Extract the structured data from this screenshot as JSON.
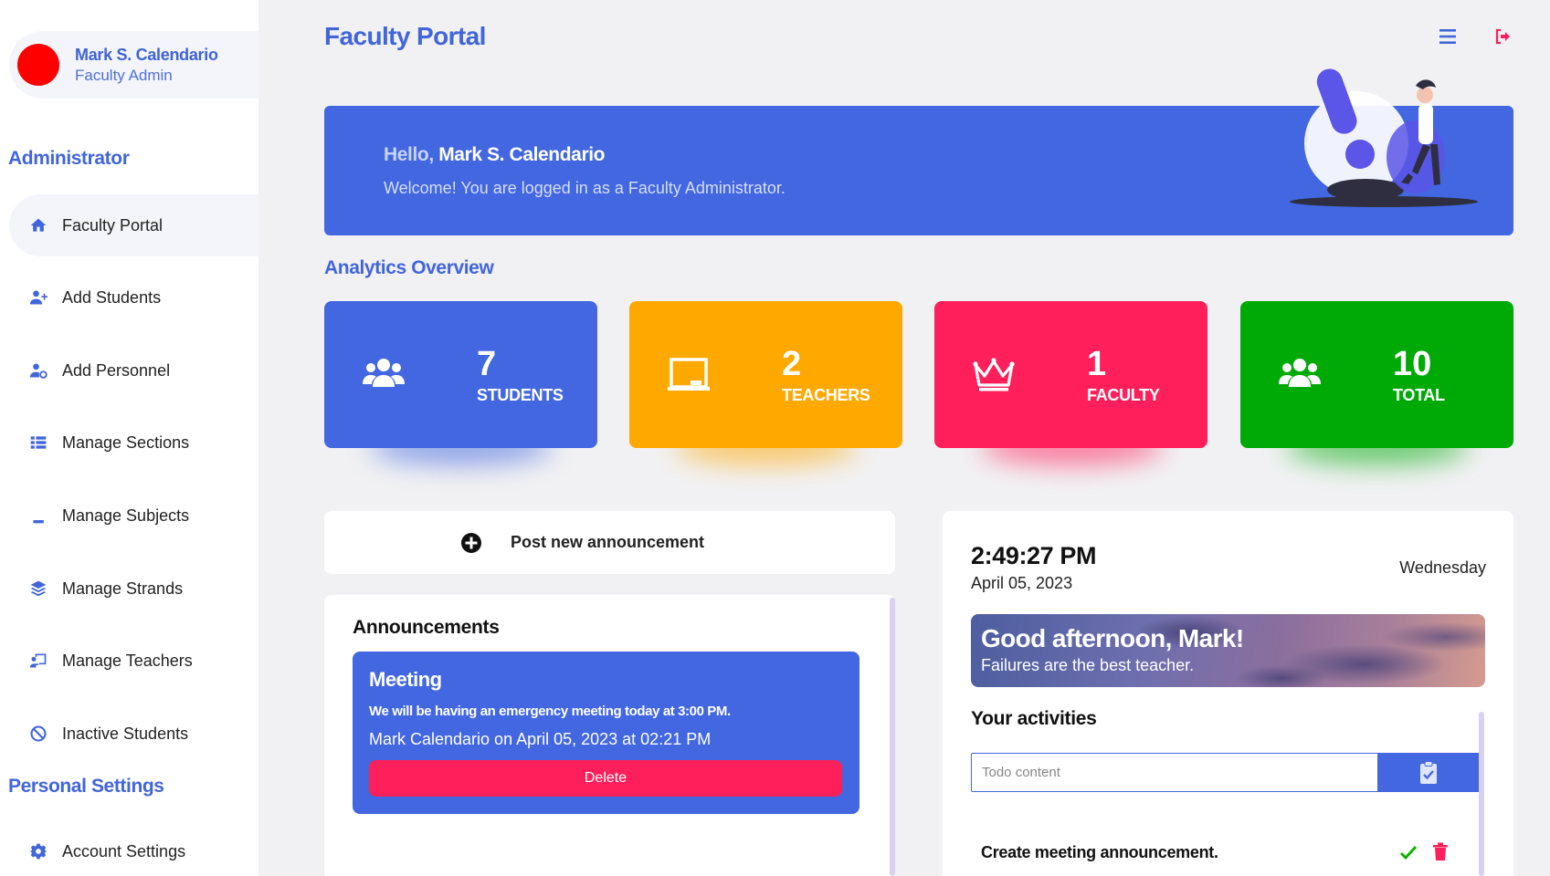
{
  "sidebar": {
    "profile": {
      "name": "Mark S. Calendario",
      "role": "Faculty Admin"
    },
    "section_admin": "Administrator",
    "items": [
      {
        "label": "Faculty Portal",
        "icon": "home-icon"
      },
      {
        "label": "Add Students",
        "icon": "user-plus-icon"
      },
      {
        "label": "Add Personnel",
        "icon": "user-cog-icon"
      },
      {
        "label": "Manage Sections",
        "icon": "list-icon"
      },
      {
        "label": "Manage Subjects",
        "icon": "book-icon"
      },
      {
        "label": "Manage Strands",
        "icon": "layers-icon"
      },
      {
        "label": "Manage Teachers",
        "icon": "chalkboard-teacher-icon"
      },
      {
        "label": "Inactive Students",
        "icon": "ban-icon"
      }
    ],
    "section_personal": "Personal Settings",
    "personal_items": [
      {
        "label": "Account Settings",
        "icon": "gear-icon"
      }
    ]
  },
  "header": {
    "title": "Faculty Portal"
  },
  "hero": {
    "hello": "Hello,",
    "name": "Mark S. Calendario",
    "welcome": "Welcome! You are logged in as a Faculty Administrator."
  },
  "analytics": {
    "title": "Analytics Overview",
    "cards": [
      {
        "value": "7",
        "label": "STUDENTS",
        "color": "#4267e0",
        "icon": "users-icon"
      },
      {
        "value": "2",
        "label": "TEACHERS",
        "color": "#ffa800",
        "icon": "chalkboard-icon"
      },
      {
        "value": "1",
        "label": "FACULTY",
        "color": "#ff1f5a",
        "icon": "crown-icon"
      },
      {
        "value": "10",
        "label": "TOTAL",
        "color": "#00aa06",
        "icon": "users-icon"
      }
    ]
  },
  "announcements": {
    "post_label": "Post new announcement",
    "title": "Announcements",
    "items": [
      {
        "title": "Meeting",
        "body": "We will be having an emergency meeting today at 3:00 PM.",
        "meta": "Mark Calendario on April 05, 2023 at 02:21 PM",
        "delete_label": "Delete"
      }
    ]
  },
  "widget": {
    "time": "2:49:27 PM",
    "date": "April 05, 2023",
    "weekday": "Wednesday",
    "greeting": "Good afternoon, Mark!",
    "quote": "Failures are the best teacher.",
    "activities_title": "Your activities",
    "todo_placeholder": "Todo content",
    "todos": [
      {
        "text": "Create meeting announcement."
      }
    ]
  },
  "colors": {
    "accent": "#4267e0",
    "danger": "#ff1f5a",
    "warning": "#ffa800",
    "success": "#00aa06"
  }
}
